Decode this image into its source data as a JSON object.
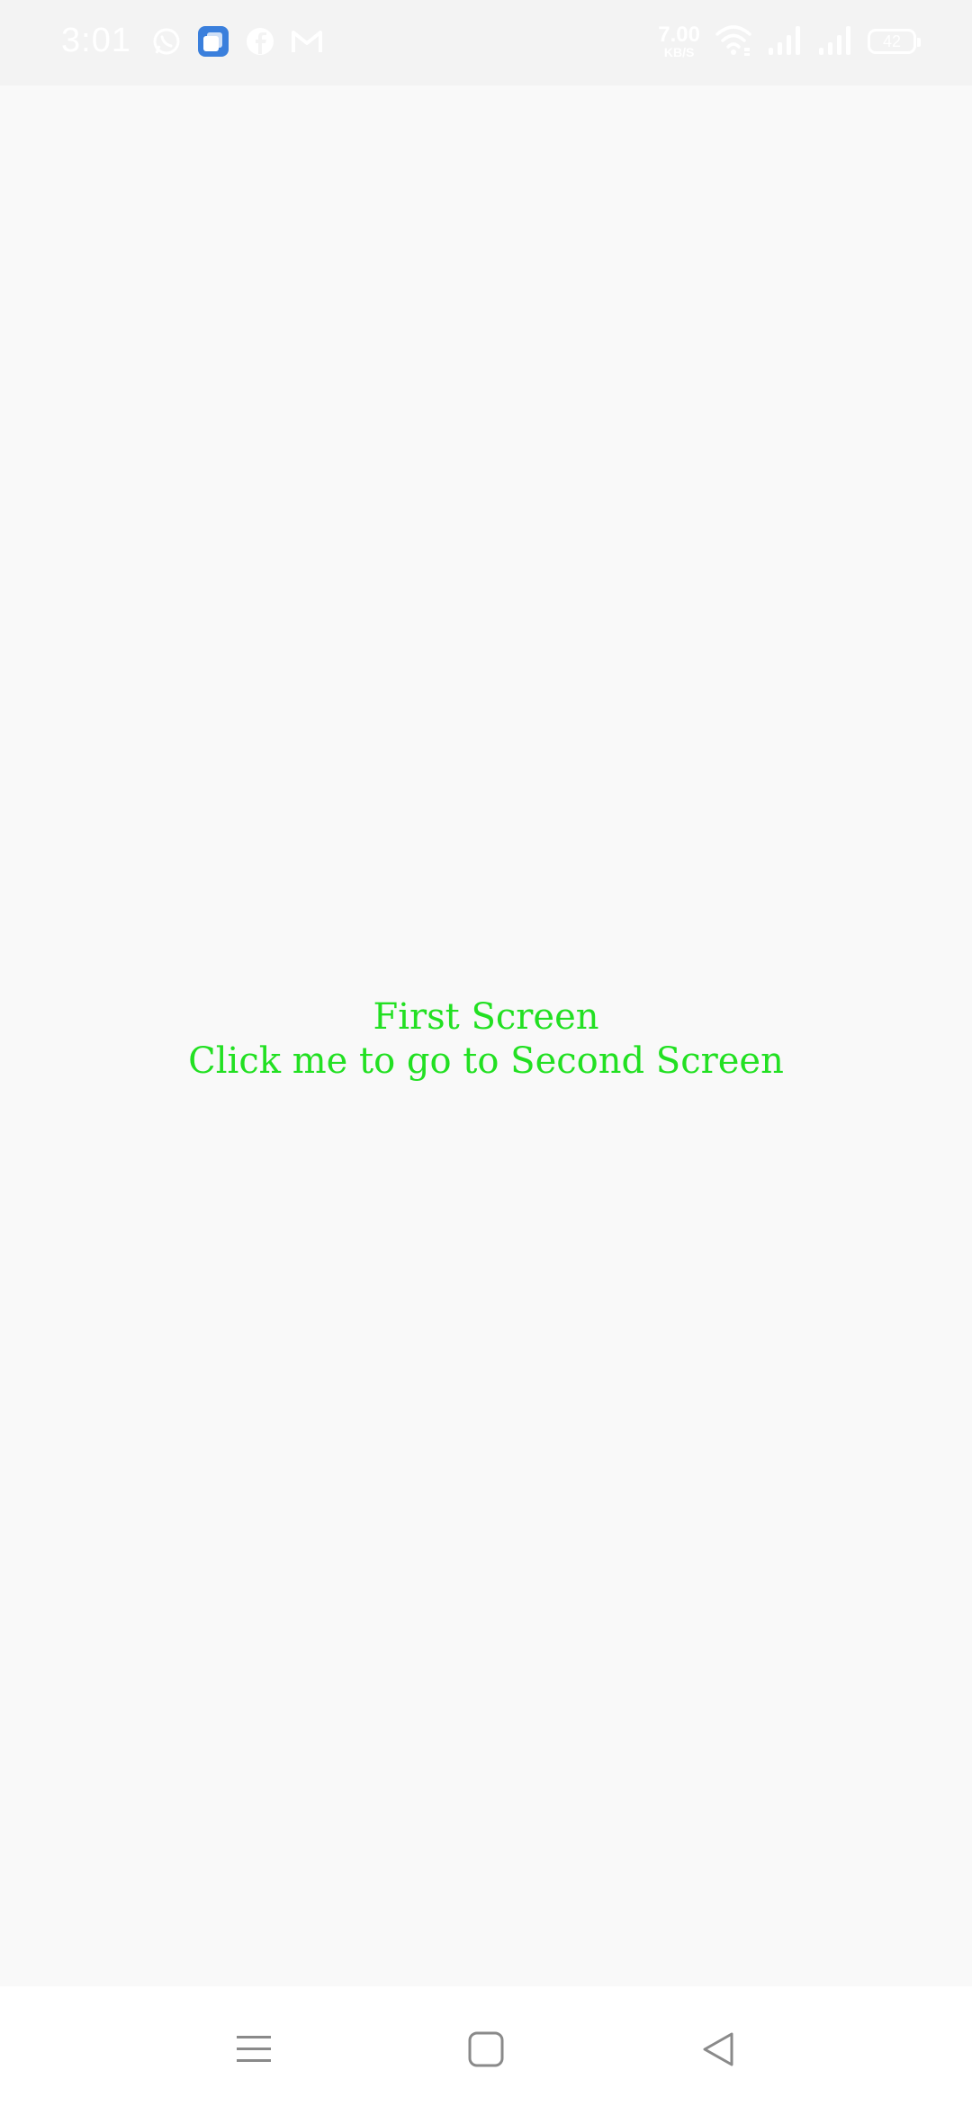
{
  "status_bar": {
    "time": "3:01",
    "net_speed_value": "7.00",
    "net_speed_unit": "KB/S",
    "battery_level": "42",
    "notification_icons": [
      "whatsapp-icon",
      "app-badge-icon",
      "facebook-icon",
      "gmail-icon"
    ],
    "system_icons": [
      "wifi-icon",
      "signal-icon",
      "signal-icon"
    ]
  },
  "main": {
    "title": "First Screen",
    "link_text": "Click me to go to Second Screen",
    "text_color": "#22e022",
    "background_color": "#f9f9f9"
  },
  "nav_bar": {
    "buttons": [
      "menu-icon",
      "home-icon",
      "back-icon"
    ]
  }
}
